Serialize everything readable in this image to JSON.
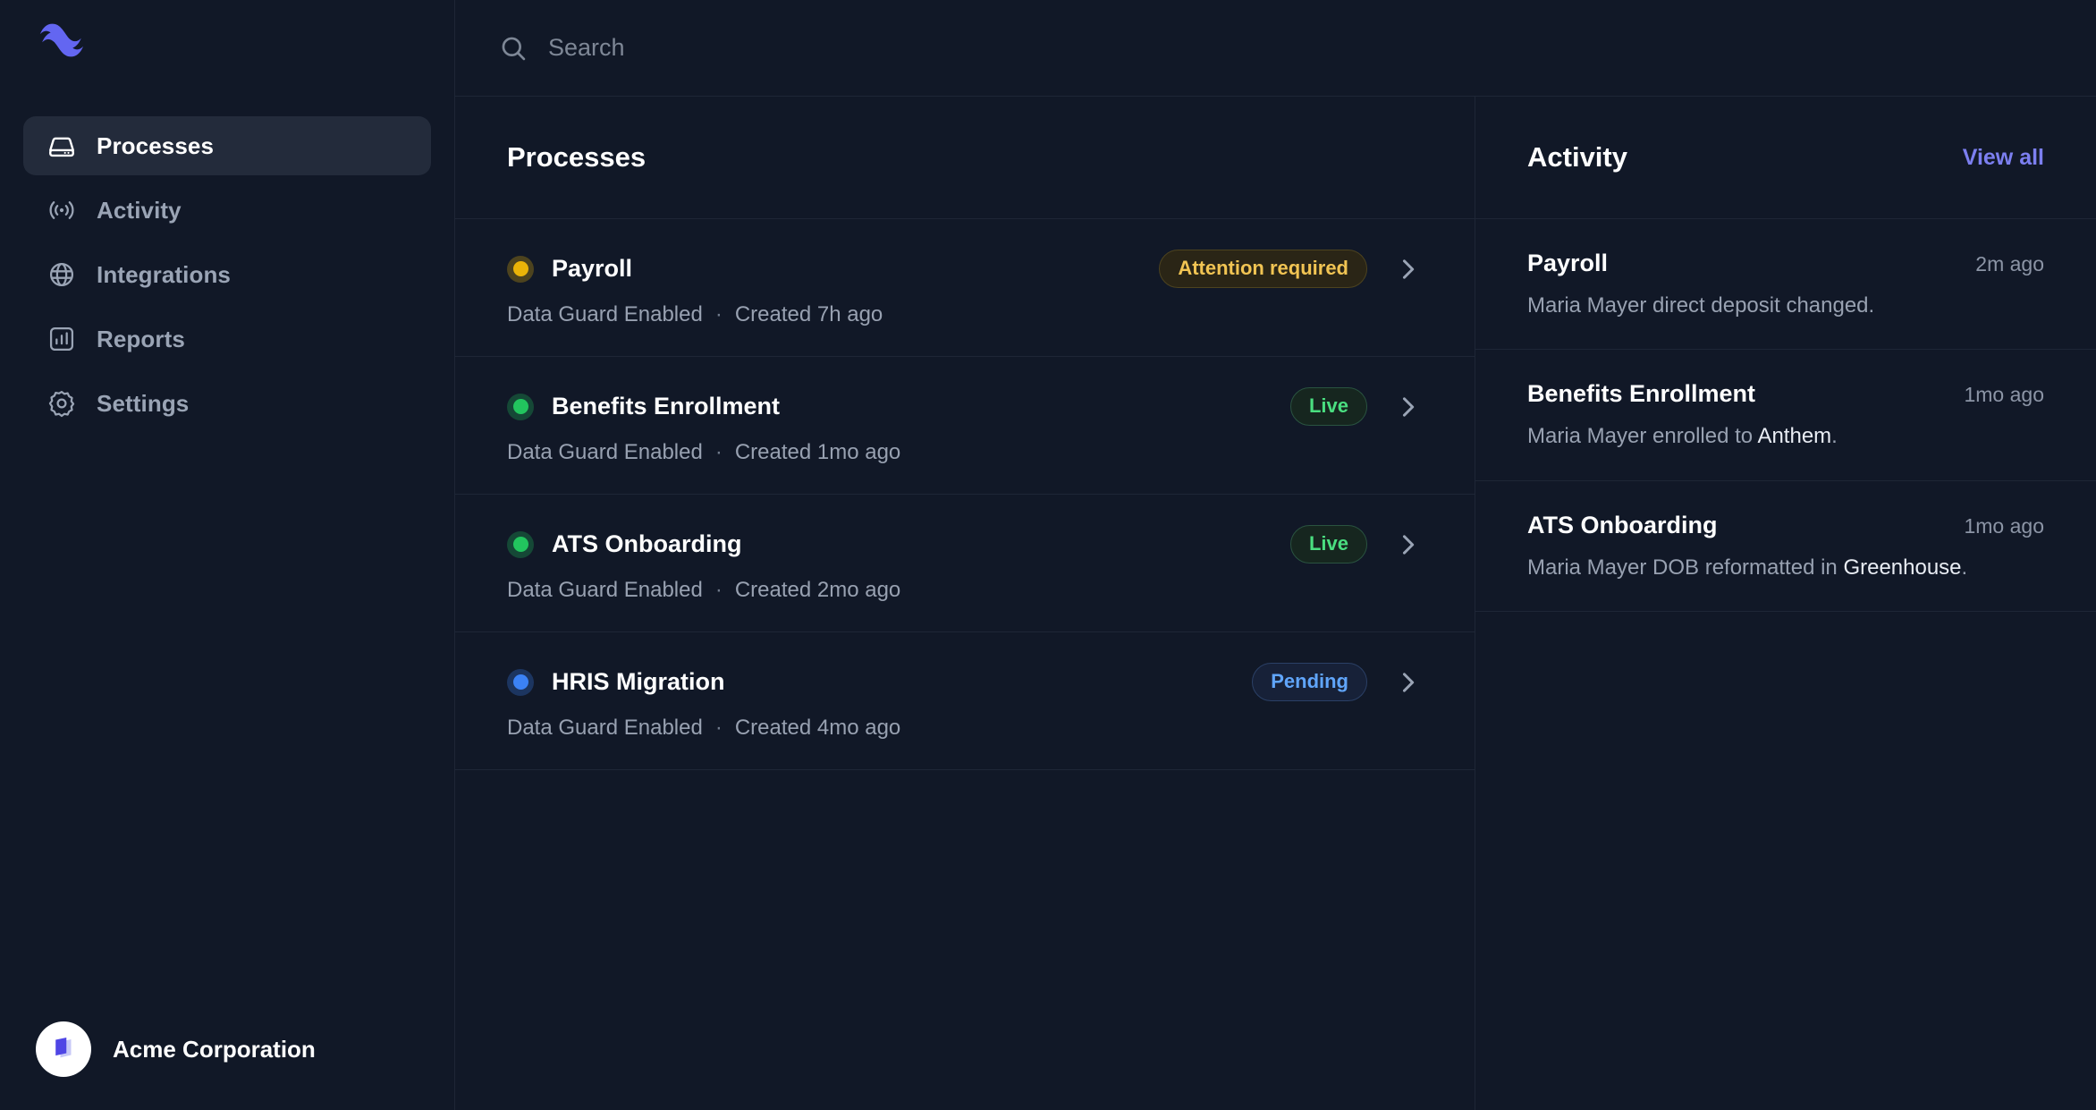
{
  "brand": {
    "logo_icon": "wave-logo-icon",
    "accent_color": "#6366f1"
  },
  "sidebar": {
    "items": [
      {
        "label": "Processes",
        "icon": "hard-drive-icon",
        "active": true
      },
      {
        "label": "Activity",
        "icon": "signal-waves-icon",
        "active": false
      },
      {
        "label": "Integrations",
        "icon": "globe-icon",
        "active": false
      },
      {
        "label": "Reports",
        "icon": "bar-chart-square-icon",
        "active": false
      },
      {
        "label": "Settings",
        "icon": "gear-icon",
        "active": false
      }
    ],
    "footer": {
      "org_name": "Acme Corporation",
      "avatar_icon": "layered-cards-icon"
    }
  },
  "search": {
    "placeholder": "Search",
    "value": "",
    "icon": "search-icon"
  },
  "processes": {
    "title": "Processes",
    "meta_separator": "·",
    "rows": [
      {
        "name": "Payroll",
        "status_color": "#eab308",
        "meta_guard": "Data Guard Enabled",
        "meta_created": "Created 7h ago",
        "badge_label": "Attention required",
        "badge_tone": "amber"
      },
      {
        "name": "Benefits Enrollment",
        "status_color": "#22c55e",
        "meta_guard": "Data Guard Enabled",
        "meta_created": "Created 1mo ago",
        "badge_label": "Live",
        "badge_tone": "green"
      },
      {
        "name": "ATS Onboarding",
        "status_color": "#22c55e",
        "meta_guard": "Data Guard Enabled",
        "meta_created": "Created 2mo ago",
        "badge_label": "Live",
        "badge_tone": "green"
      },
      {
        "name": "HRIS Migration",
        "status_color": "#3b82f6",
        "meta_guard": "Data Guard Enabled",
        "meta_created": "Created 4mo ago",
        "badge_label": "Pending",
        "badge_tone": "blue"
      }
    ]
  },
  "activity": {
    "title": "Activity",
    "view_all_label": "View all",
    "rows": [
      {
        "title": "Payroll",
        "time": "2m ago",
        "desc_before": "Maria Mayer direct deposit changed.",
        "desc_highlight": "",
        "desc_after": ""
      },
      {
        "title": "Benefits Enrollment",
        "time": "1mo ago",
        "desc_before": "Maria Mayer enrolled to ",
        "desc_highlight": "Anthem",
        "desc_after": "."
      },
      {
        "title": "ATS Onboarding",
        "time": "1mo ago",
        "desc_before": "Maria Mayer DOB reformatted in ",
        "desc_highlight": "Greenhouse",
        "desc_after": "."
      }
    ]
  }
}
